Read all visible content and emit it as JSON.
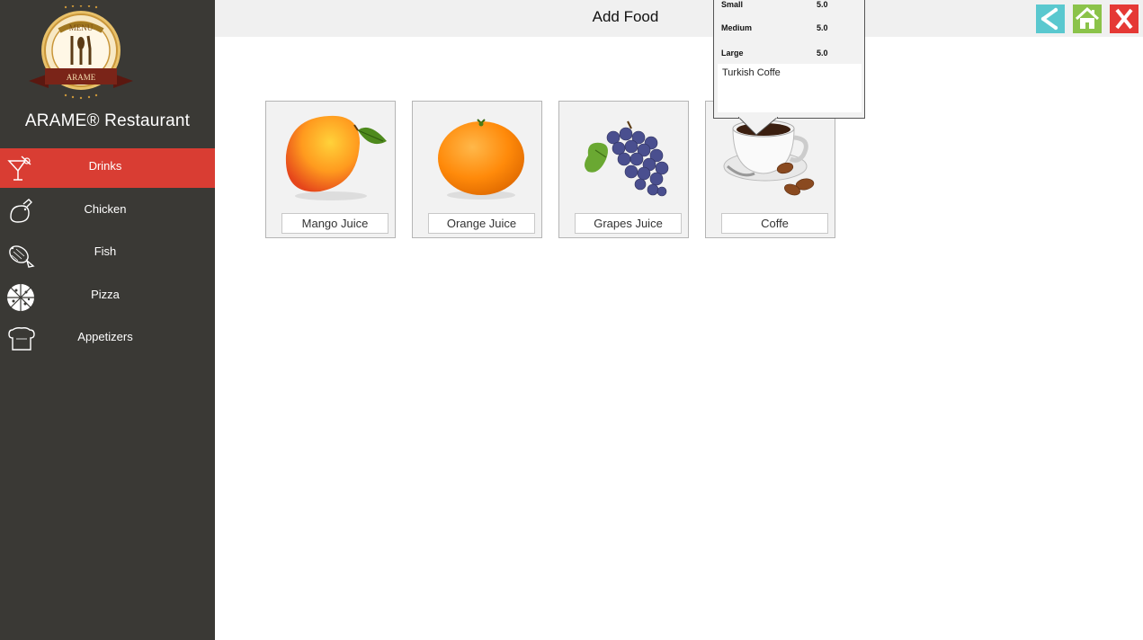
{
  "sidebar": {
    "logo": {
      "top_text": "MENU",
      "ribbon_text": "ARAME"
    },
    "restaurant_name": "ARAME® Restaurant",
    "items": [
      {
        "label": "Drinks",
        "icon": "drink-icon",
        "active": true
      },
      {
        "label": "Chicken",
        "icon": "chicken-icon",
        "active": false
      },
      {
        "label": "Fish",
        "icon": "fish-icon",
        "active": false
      },
      {
        "label": "Pizza",
        "icon": "pizza-icon",
        "active": false
      },
      {
        "label": "Appetizers",
        "icon": "appetizer-icon",
        "active": false
      }
    ]
  },
  "header": {
    "title": "Add Food",
    "buttons": [
      {
        "icon": "back-icon",
        "color": "#5ac8cf"
      },
      {
        "icon": "home-icon",
        "color": "#8bc34a"
      },
      {
        "icon": "close-icon",
        "color": "#e53935"
      }
    ]
  },
  "items": [
    {
      "label": "Mango Juice",
      "icon": "mango-icon"
    },
    {
      "label": "Orange Juice",
      "icon": "orange-icon"
    },
    {
      "label": "Grapes Juice",
      "icon": "grapes-icon"
    },
    {
      "label": "Coffe",
      "icon": "coffee-icon"
    }
  ],
  "popup": {
    "sizes": [
      {
        "size": "Small",
        "price": "5.0"
      },
      {
        "size": "Medium",
        "price": "5.0"
      },
      {
        "size": "Large",
        "price": "5.0"
      }
    ],
    "description": "Turkish Coffe"
  },
  "colors": {
    "sidebar_bg": "#3a3935",
    "active_item": "#d93d33",
    "header_bg": "#f0f0f0"
  }
}
